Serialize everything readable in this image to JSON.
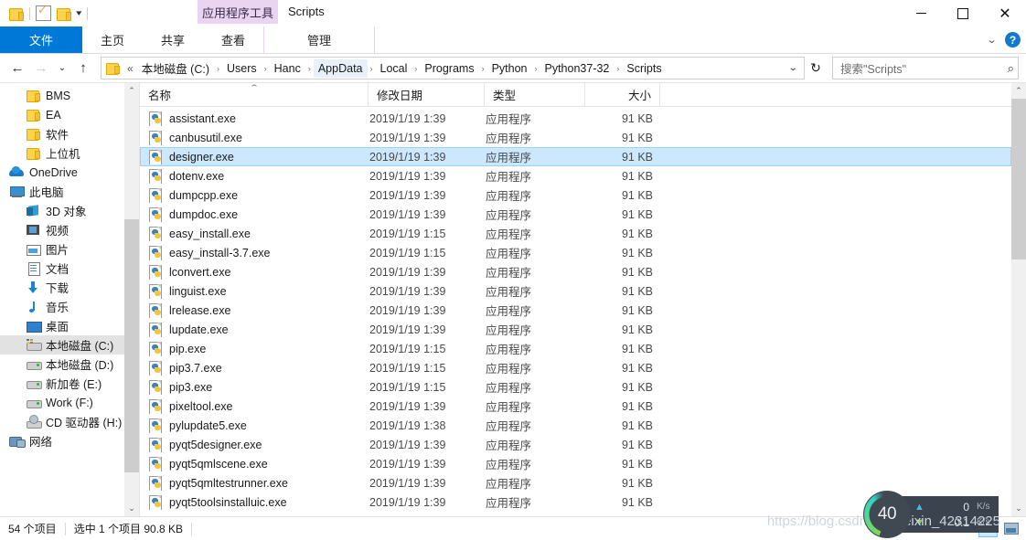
{
  "window": {
    "title": "Scripts",
    "contextual_tab": "应用程序工具",
    "minimize": "—",
    "maximize": "□",
    "close": "✕"
  },
  "quick_access": {
    "items": [
      {
        "name": "folder-icon",
        "label": ""
      },
      {
        "name": "properties-icon",
        "label": ""
      },
      {
        "name": "new-folder-icon",
        "label": ""
      },
      {
        "name": "customize-dropdown",
        "label": "▾"
      }
    ]
  },
  "ribbon": {
    "tabs": [
      {
        "label": "文件",
        "active": true
      },
      {
        "label": "主页",
        "active": false
      },
      {
        "label": "共享",
        "active": false
      },
      {
        "label": "查看",
        "active": false
      },
      {
        "label": "管理",
        "active": false,
        "contextual": true
      }
    ],
    "collapse_caret": "⌄",
    "help_label": "?"
  },
  "address": {
    "back": "←",
    "forward": "→",
    "history": "⌄",
    "up": "↑",
    "double_chevron": "«",
    "crumbs": [
      {
        "label": "本地磁盘 (C:)",
        "highlight": false
      },
      {
        "label": "Users",
        "highlight": false
      },
      {
        "label": "Hanc",
        "highlight": false
      },
      {
        "label": "AppData",
        "highlight": true
      },
      {
        "label": "Local",
        "highlight": false
      },
      {
        "label": "Programs",
        "highlight": false
      },
      {
        "label": "Python",
        "highlight": false
      },
      {
        "label": "Python37-32",
        "highlight": false
      },
      {
        "label": "Scripts",
        "highlight": false
      }
    ],
    "separator": "›",
    "dropdown": "⌄",
    "refresh": "↻"
  },
  "search": {
    "placeholder": "搜索\"Scripts\"",
    "icon": "⌕"
  },
  "sidebar": {
    "items": [
      {
        "label": "BMS",
        "icon": "folder",
        "level": 1,
        "selected": false
      },
      {
        "label": "EA",
        "icon": "folder",
        "level": 1,
        "selected": false
      },
      {
        "label": "软件",
        "icon": "folder",
        "level": 1,
        "selected": false
      },
      {
        "label": "上位机",
        "icon": "folder",
        "level": 1,
        "selected": false
      },
      {
        "label": "OneDrive",
        "icon": "cloud",
        "level": 0,
        "selected": false
      },
      {
        "label": "此电脑",
        "icon": "pc",
        "level": 0,
        "selected": false
      },
      {
        "label": "3D 对象",
        "icon": "obj3d",
        "level": 1,
        "selected": false
      },
      {
        "label": "视频",
        "icon": "video",
        "level": 1,
        "selected": false
      },
      {
        "label": "图片",
        "icon": "pic",
        "level": 1,
        "selected": false
      },
      {
        "label": "文档",
        "icon": "doc",
        "level": 1,
        "selected": false
      },
      {
        "label": "下载",
        "icon": "dl",
        "level": 1,
        "selected": false
      },
      {
        "label": "音乐",
        "icon": "music",
        "level": 1,
        "selected": false
      },
      {
        "label": "桌面",
        "icon": "desktop",
        "level": 1,
        "selected": false
      },
      {
        "label": "本地磁盘 (C:)",
        "icon": "drivec",
        "level": 1,
        "selected": true
      },
      {
        "label": "本地磁盘 (D:)",
        "icon": "drive",
        "level": 1,
        "selected": false
      },
      {
        "label": "新加卷 (E:)",
        "icon": "drive",
        "level": 1,
        "selected": false
      },
      {
        "label": "Work (F:)",
        "icon": "drive",
        "level": 1,
        "selected": false
      },
      {
        "label": "CD 驱动器 (H:)",
        "icon": "cd",
        "level": 1,
        "selected": false
      },
      {
        "label": "网络",
        "icon": "net",
        "level": 0,
        "selected": false
      }
    ],
    "scroll": {
      "up_arrow": "⌃",
      "down_arrow": "⌄",
      "thumb_top_pct": 30,
      "thumb_height_pct": 63
    }
  },
  "filelist": {
    "columns": [
      {
        "label": "名称",
        "key": "name"
      },
      {
        "label": "修改日期",
        "key": "date"
      },
      {
        "label": "类型",
        "key": "type"
      },
      {
        "label": "大小",
        "key": "size"
      }
    ],
    "sort_caret": "⌃",
    "rows": [
      {
        "name": "assistant.exe",
        "date": "2019/1/19 1:39",
        "type": "应用程序",
        "size": "91 KB",
        "selected": false
      },
      {
        "name": "canbusutil.exe",
        "date": "2019/1/19 1:39",
        "type": "应用程序",
        "size": "91 KB",
        "selected": false
      },
      {
        "name": "designer.exe",
        "date": "2019/1/19 1:39",
        "type": "应用程序",
        "size": "91 KB",
        "selected": true
      },
      {
        "name": "dotenv.exe",
        "date": "2019/1/19 1:39",
        "type": "应用程序",
        "size": "91 KB",
        "selected": false
      },
      {
        "name": "dumpcpp.exe",
        "date": "2019/1/19 1:39",
        "type": "应用程序",
        "size": "91 KB",
        "selected": false
      },
      {
        "name": "dumpdoc.exe",
        "date": "2019/1/19 1:39",
        "type": "应用程序",
        "size": "91 KB",
        "selected": false
      },
      {
        "name": "easy_install.exe",
        "date": "2019/1/19 1:15",
        "type": "应用程序",
        "size": "91 KB",
        "selected": false
      },
      {
        "name": "easy_install-3.7.exe",
        "date": "2019/1/19 1:15",
        "type": "应用程序",
        "size": "91 KB",
        "selected": false
      },
      {
        "name": "lconvert.exe",
        "date": "2019/1/19 1:39",
        "type": "应用程序",
        "size": "91 KB",
        "selected": false
      },
      {
        "name": "linguist.exe",
        "date": "2019/1/19 1:39",
        "type": "应用程序",
        "size": "91 KB",
        "selected": false
      },
      {
        "name": "lrelease.exe",
        "date": "2019/1/19 1:39",
        "type": "应用程序",
        "size": "91 KB",
        "selected": false
      },
      {
        "name": "lupdate.exe",
        "date": "2019/1/19 1:39",
        "type": "应用程序",
        "size": "91 KB",
        "selected": false
      },
      {
        "name": "pip.exe",
        "date": "2019/1/19 1:15",
        "type": "应用程序",
        "size": "91 KB",
        "selected": false
      },
      {
        "name": "pip3.7.exe",
        "date": "2019/1/19 1:15",
        "type": "应用程序",
        "size": "91 KB",
        "selected": false
      },
      {
        "name": "pip3.exe",
        "date": "2019/1/19 1:15",
        "type": "应用程序",
        "size": "91 KB",
        "selected": false
      },
      {
        "name": "pixeltool.exe",
        "date": "2019/1/19 1:39",
        "type": "应用程序",
        "size": "91 KB",
        "selected": false
      },
      {
        "name": "pylupdate5.exe",
        "date": "2019/1/19 1:38",
        "type": "应用程序",
        "size": "91 KB",
        "selected": false
      },
      {
        "name": "pyqt5designer.exe",
        "date": "2019/1/19 1:39",
        "type": "应用程序",
        "size": "91 KB",
        "selected": false
      },
      {
        "name": "pyqt5qmlscene.exe",
        "date": "2019/1/19 1:39",
        "type": "应用程序",
        "size": "91 KB",
        "selected": false
      },
      {
        "name": "pyqt5qmltestrunner.exe",
        "date": "2019/1/19 1:39",
        "type": "应用程序",
        "size": "91 KB",
        "selected": false
      },
      {
        "name": "pyqt5toolsinstalluic.exe",
        "date": "2019/1/19 1:39",
        "type": "应用程序",
        "size": "91 KB",
        "selected": false
      }
    ],
    "scroll": {
      "up_arrow": "⌃",
      "down_arrow": "⌄",
      "thumb_top_pct": 0,
      "thumb_height_pct": 40
    }
  },
  "statusbar": {
    "item_count": "54 个项目",
    "selection": "选中 1 个项目  90.8 KB",
    "view_details_title": "详细信息",
    "view_largeicons_title": "大图标"
  },
  "overlay": {
    "gauge_value": "40",
    "upload_value": "0",
    "upload_unit": "K/s",
    "upload_arrow": "▲",
    "download_value": "0.1",
    "download_unit": "K/s",
    "download_arrow": "▼",
    "watermark": "https://blog.csdn.net/weixin_42314225"
  }
}
